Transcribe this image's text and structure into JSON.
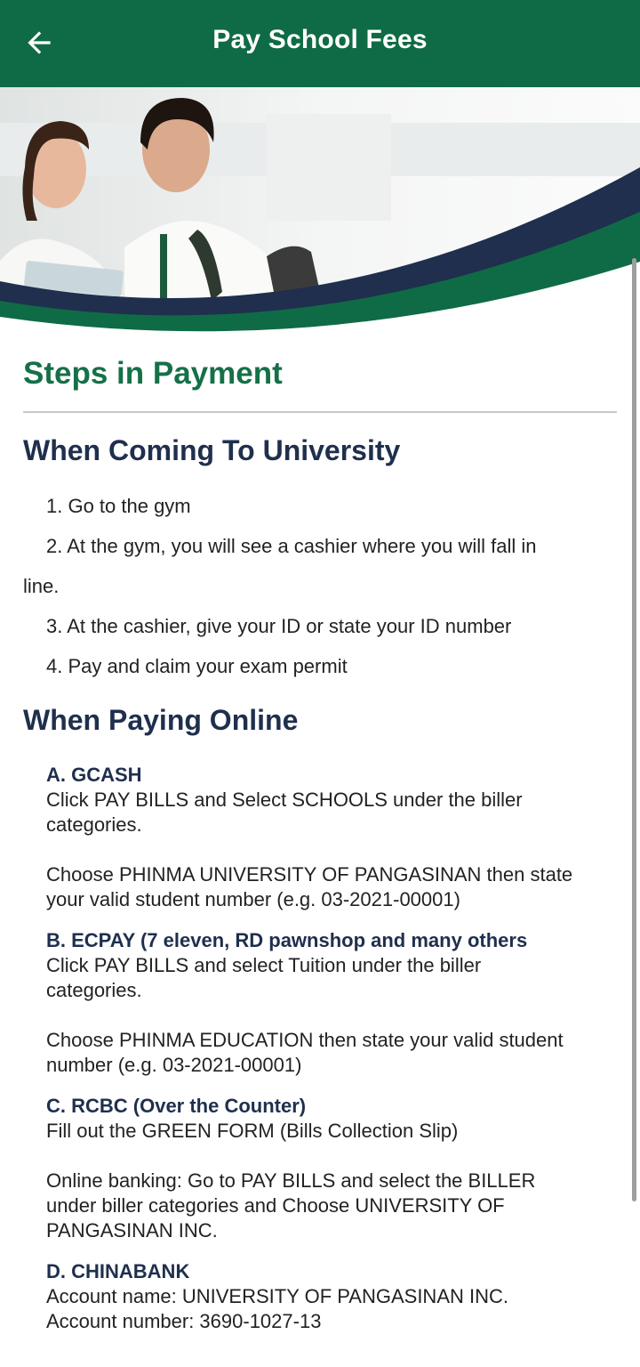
{
  "appbar": {
    "title": "Pay School Fees",
    "back_icon": "arrow-left-icon"
  },
  "colors": {
    "primary": "#0f6b45",
    "heading": "#167048",
    "navy": "#1f2f4d"
  },
  "steps_title": "Steps in Payment",
  "university": {
    "title": "When Coming To University",
    "steps": [
      "1. Go to the gym",
      "2. At the gym, you will see a cashier where you will fall in",
      "line.",
      "3. At the cashier, give your ID or state your ID number",
      "4. Pay and claim your exam permit"
    ]
  },
  "online": {
    "title": "When Paying Online",
    "options": [
      {
        "head": "A. GCASH",
        "lines": [
          "Click PAY BILLS and Select SCHOOLS under the biller",
          "categories.",
          "",
          "Choose PHINMA UNIVERSITY OF PANGASINAN then state",
          "your valid student number (e.g. 03-2021-00001)"
        ]
      },
      {
        "head": "B. ECPAY (7 eleven, RD pawnshop and many others",
        "lines": [
          "Click PAY BILLS and select Tuition under the biller",
          "categories.",
          "",
          "Choose PHINMA EDUCATION then state your valid student",
          "number (e.g. 03-2021-00001)"
        ]
      },
      {
        "head": "C. RCBC (Over the Counter)",
        "lines": [
          "Fill out the GREEN FORM (Bills Collection Slip)",
          "",
          "Online banking: Go to PAY BILLS and select the BILLER",
          "under biller categories and Choose UNIVERSITY OF",
          "PANGASINAN INC."
        ]
      },
      {
        "head": "D. CHINABANK",
        "lines": [
          "Account name: UNIVERSITY OF PANGASINAN INC.",
          "Account number: 3690-1027-13"
        ]
      }
    ]
  }
}
